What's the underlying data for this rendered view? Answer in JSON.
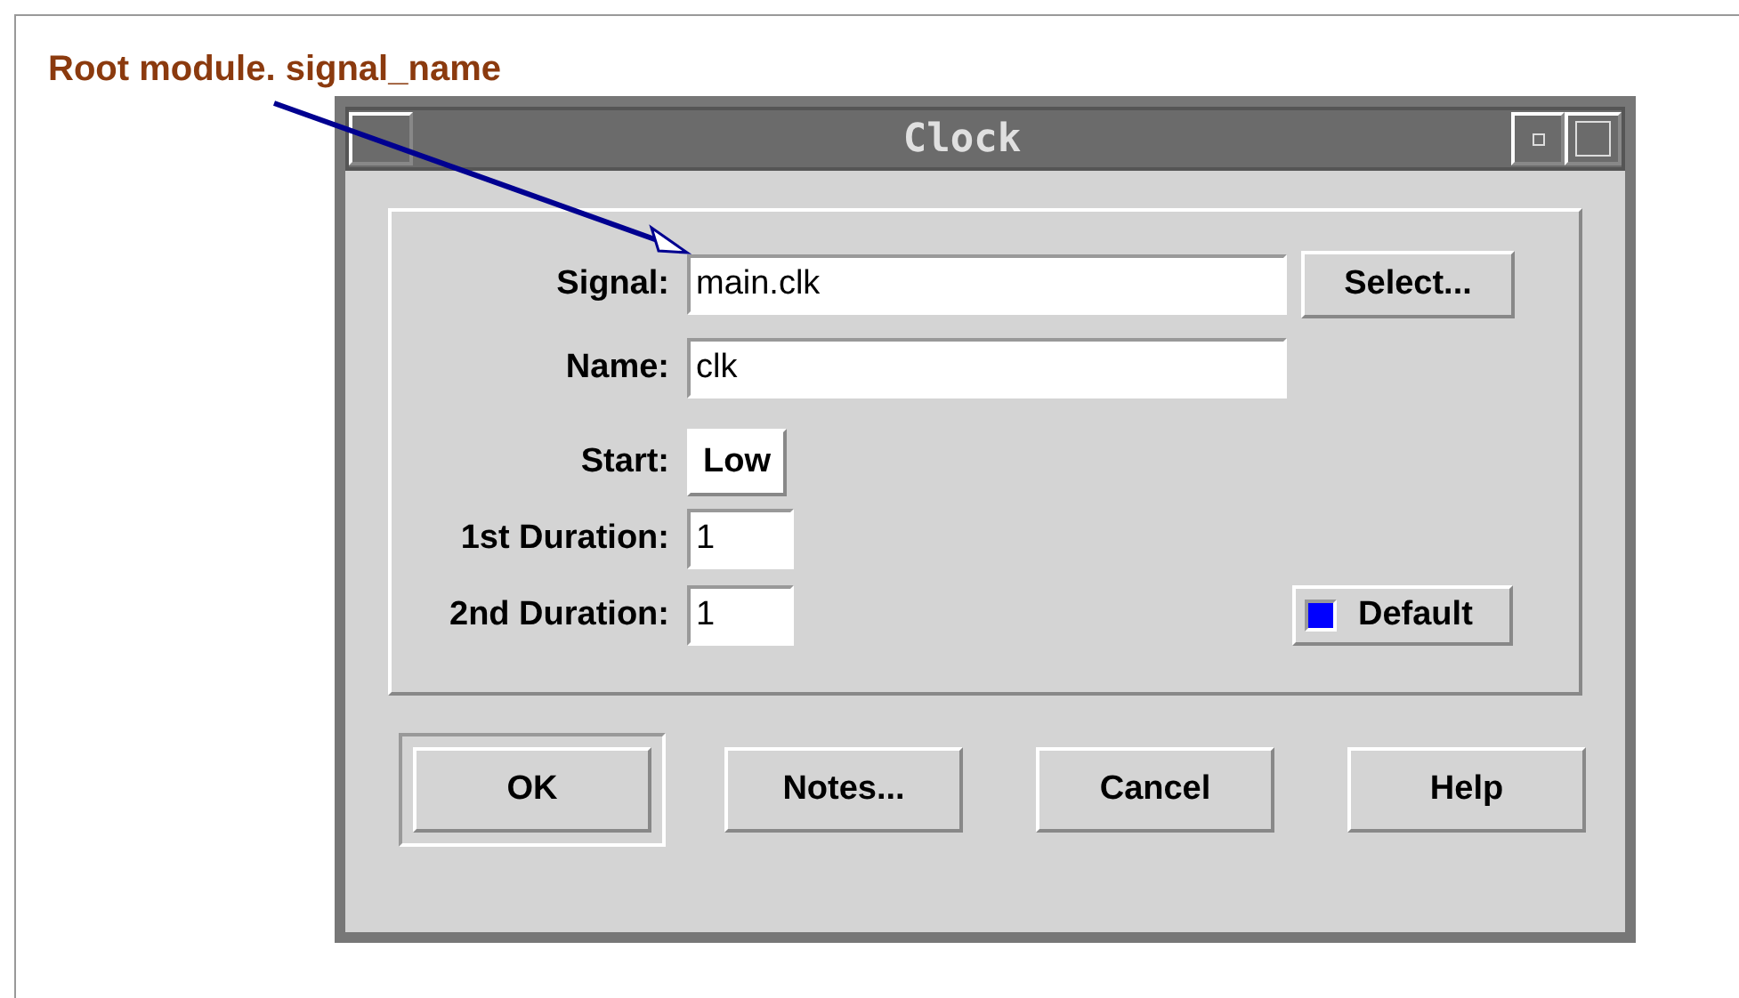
{
  "annotation": {
    "text": "Root module. signal_name"
  },
  "window": {
    "title": "Clock"
  },
  "form": {
    "signal": {
      "label": "Signal:",
      "value": "main.clk"
    },
    "select_button": "Select...",
    "name": {
      "label": "Name:",
      "value": "clk"
    },
    "start": {
      "label": "Start:",
      "value": "Low"
    },
    "first_duration": {
      "label": "1st Duration:",
      "value": "1"
    },
    "second_duration": {
      "label": "2nd Duration:",
      "value": "1"
    },
    "default_toggle": {
      "label": "Default",
      "checked": true
    }
  },
  "buttons": [
    {
      "label": "OK",
      "is_default": true
    },
    {
      "label": "Notes...",
      "is_default": false
    },
    {
      "label": "Cancel",
      "is_default": false
    },
    {
      "label": "Help",
      "is_default": false
    }
  ]
}
